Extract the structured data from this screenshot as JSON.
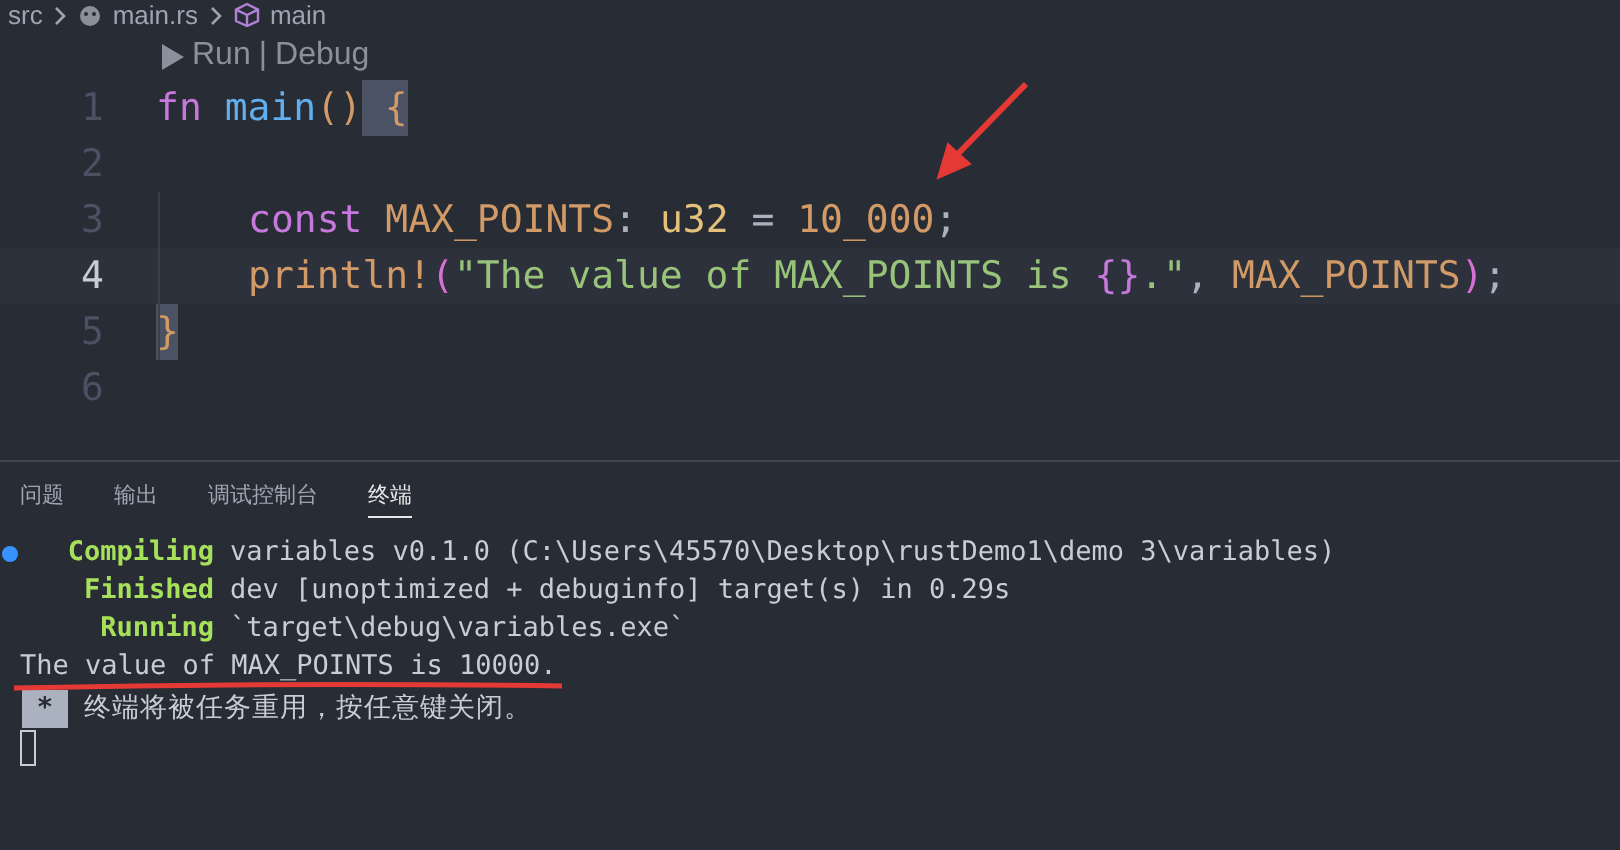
{
  "breadcrumb": [
    "src",
    "main.rs",
    "main"
  ],
  "codelens": [
    "Run",
    "|",
    "Debug"
  ],
  "editor": {
    "lines": [
      {
        "number": "1",
        "current": false,
        "indented": false,
        "tokens": [
          {
            "text": "fn",
            "kind": "keyword"
          },
          {
            "text": " main",
            "kind": "function"
          },
          {
            "text": "()",
            "kind": "bracket1"
          },
          {
            "text": " {",
            "kind": "bracket-matched"
          }
        ]
      },
      {
        "number": "2",
        "current": false
      },
      {
        "number": "3",
        "current": false,
        "indented": true,
        "tokens": [
          {
            "text": "const",
            "kind": "keyword"
          },
          {
            "text": " MAX_POINTS",
            "kind": "constant"
          },
          {
            "text": ":",
            "kind": "punct"
          },
          {
            "text": " u32",
            "kind": "type"
          },
          {
            "text": " =",
            "kind": "punct"
          },
          {
            "text": " 10_000",
            "kind": "number"
          },
          {
            "text": ";",
            "kind": "punct"
          }
        ]
      },
      {
        "number": "4",
        "current": true,
        "indented": true,
        "tokens": [
          {
            "text": "println!",
            "kind": "macro"
          },
          {
            "text": "(",
            "kind": "bracket2"
          },
          {
            "text": "\"The value of MAX_POINTS is ",
            "kind": "string"
          },
          {
            "text": "{}",
            "kind": "placeholder"
          },
          {
            "text": ".\"",
            "kind": "string"
          },
          {
            "text": ",",
            "kind": "punct"
          },
          {
            "text": " MAX_POINTS",
            "kind": "constant"
          },
          {
            "text": ")",
            "kind": "bracket2"
          },
          {
            "text": ";",
            "kind": "punct"
          }
        ]
      },
      {
        "number": "5",
        "current": false,
        "indented": false,
        "tokens": [
          {
            "text": "}",
            "kind": "bracket-matched"
          }
        ]
      },
      {
        "number": "6",
        "current": false
      }
    ]
  },
  "panel_tabs": [
    {
      "label": "问题",
      "selected": false
    },
    {
      "label": "输出",
      "selected": false
    },
    {
      "label": "调试控制台",
      "selected": false
    },
    {
      "label": "终端",
      "selected": true
    }
  ],
  "terminal": [
    {
      "kind": "status",
      "label": "Compiling",
      "text": "variables v0.1.0 (C:\\Users\\45570\\Desktop\\rustDemo1\\demo 3\\variables)"
    },
    {
      "kind": "status",
      "label": "Finished",
      "text": "dev [unoptimized + debuginfo] target(s) in 0.29s"
    },
    {
      "kind": "status",
      "label": "Running",
      "text": "`target\\debug\\variables.exe`"
    },
    {
      "kind": "output",
      "text": "The value of MAX_POINTS is 10000."
    },
    {
      "kind": "notice",
      "label": "*",
      "text": "终端将被任务重用，按任意键关闭。"
    }
  ]
}
